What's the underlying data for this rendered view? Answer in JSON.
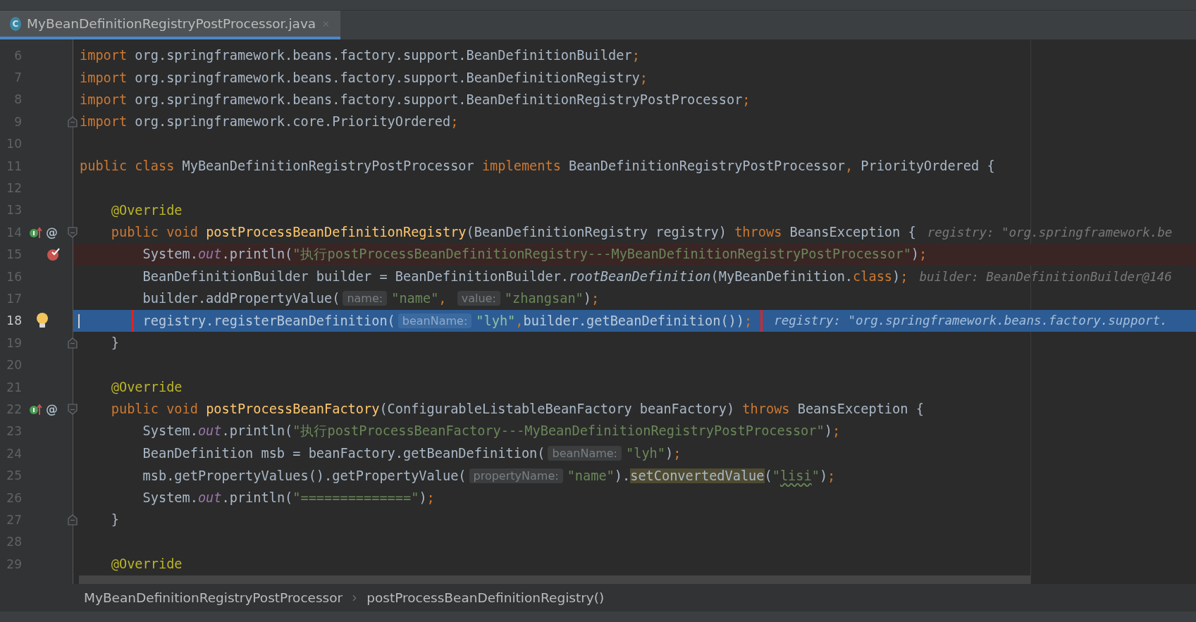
{
  "tab": {
    "icon_letter": "C",
    "title": "MyBeanDefinitionRegistryPostProcessor.java",
    "selected": true
  },
  "lines": [
    {
      "number": "6",
      "current": false,
      "breakpoint": false,
      "boxed": false,
      "parts": [
        {
          "kind": "code",
          "tokens": [
            {
              "kind": "kw",
              "text": "import"
            },
            {
              "kind": "plain",
              "text": " org.springframework.beans.factory.support.BeanDefinitionBuilder"
            },
            {
              "kind": "kw",
              "text": ";"
            }
          ]
        }
      ]
    },
    {
      "number": "7",
      "current": false,
      "breakpoint": false,
      "boxed": false,
      "parts": [
        {
          "kind": "code",
          "tokens": [
            {
              "kind": "kw",
              "text": "import"
            },
            {
              "kind": "plain",
              "text": " org.springframework.beans.factory.support.BeanDefinitionRegistry"
            },
            {
              "kind": "kw",
              "text": ";"
            }
          ]
        }
      ]
    },
    {
      "number": "8",
      "current": false,
      "breakpoint": false,
      "boxed": false,
      "parts": [
        {
          "kind": "code",
          "tokens": [
            {
              "kind": "kw",
              "text": "import"
            },
            {
              "kind": "plain",
              "text": " org.springframework.beans.factory.support.BeanDefinitionRegistryPostProcessor"
            },
            {
              "kind": "kw",
              "text": ";"
            }
          ]
        }
      ]
    },
    {
      "number": "9",
      "current": false,
      "breakpoint": false,
      "boxed": false,
      "gutter": [
        {
          "kind": "fold_end"
        }
      ],
      "parts": [
        {
          "kind": "code",
          "tokens": [
            {
              "kind": "kw",
              "text": "import"
            },
            {
              "kind": "plain",
              "text": " org.springframework.core.PriorityOrdered"
            },
            {
              "kind": "kw",
              "text": ";"
            }
          ]
        }
      ]
    },
    {
      "number": "10",
      "current": false,
      "breakpoint": false,
      "boxed": false
    },
    {
      "number": "11",
      "current": false,
      "breakpoint": false,
      "boxed": false,
      "parts": [
        {
          "kind": "code",
          "tokens": [
            {
              "kind": "kw",
              "text": "public class "
            },
            {
              "kind": "plain",
              "text": "MyBeanDefinitionRegistryPostProcessor "
            },
            {
              "kind": "kw",
              "text": "implements "
            },
            {
              "kind": "plain",
              "text": "BeanDefinitionRegistryPostProcessor"
            },
            {
              "kind": "kw",
              "text": ","
            },
            {
              "kind": "plain",
              "text": " PriorityOrdered {"
            }
          ]
        }
      ]
    },
    {
      "number": "12",
      "current": false,
      "breakpoint": false,
      "boxed": false
    },
    {
      "number": "13",
      "current": false,
      "breakpoint": false,
      "boxed": false,
      "parts": [
        {
          "kind": "code",
          "tokens": [
            {
              "kind": "ann",
              "text": "    @Override"
            }
          ]
        }
      ]
    },
    {
      "number": "14",
      "current": false,
      "breakpoint": false,
      "boxed": false,
      "gutter": [
        {
          "kind": "implements"
        },
        {
          "kind": "override",
          "text": "@"
        },
        {
          "kind": "fold_start"
        }
      ],
      "parts": [
        {
          "kind": "code",
          "tokens": [
            {
              "kind": "kw",
              "text": "    public void "
            },
            {
              "kind": "method",
              "text": "postProcessBeanDefinitionRegistry"
            },
            {
              "kind": "plain",
              "text": "(BeanDefinitionRegistry registry) "
            },
            {
              "kind": "kw",
              "text": "throws "
            },
            {
              "kind": "plain",
              "text": "BeansException {"
            }
          ]
        },
        {
          "kind": "debug",
          "text": "registry: \"org.springframework.be"
        }
      ]
    },
    {
      "number": "15",
      "current": false,
      "breakpoint": true,
      "boxed": false,
      "gutter": [
        {
          "kind": "breakpoint"
        }
      ],
      "parts": [
        {
          "kind": "code",
          "tokens": [
            {
              "kind": "plain",
              "text": "        System."
            },
            {
              "kind": "field",
              "text": "out"
            },
            {
              "kind": "plain",
              "text": ".println("
            },
            {
              "kind": "str",
              "text": "\"执行postProcessBeanDefinitionRegistry---MyBeanDefinitionRegistryPostProcessor\""
            },
            {
              "kind": "plain",
              "text": ")"
            },
            {
              "kind": "kw",
              "text": ";"
            }
          ]
        }
      ]
    },
    {
      "number": "16",
      "current": false,
      "breakpoint": false,
      "boxed": false,
      "parts": [
        {
          "kind": "code",
          "tokens": [
            {
              "kind": "plain",
              "text": "        BeanDefinitionBuilder builder = BeanDefinitionBuilder."
            },
            {
              "kind": "italic",
              "text": "rootBeanDefinition"
            },
            {
              "kind": "plain",
              "text": "(MyBeanDefinition."
            },
            {
              "kind": "kw",
              "text": "class"
            },
            {
              "kind": "plain",
              "text": ")"
            },
            {
              "kind": "kw",
              "text": ";"
            }
          ]
        },
        {
          "kind": "debug",
          "text": "builder: BeanDefinitionBuilder@146"
        }
      ]
    },
    {
      "number": "17",
      "current": false,
      "breakpoint": false,
      "boxed": false,
      "parts": [
        {
          "kind": "code",
          "tokens": [
            {
              "kind": "plain",
              "text": "        builder.addPropertyValue("
            }
          ]
        },
        {
          "kind": "hint",
          "text": "name:"
        },
        {
          "kind": "code",
          "tokens": [
            {
              "kind": "str",
              "text": "\"name\""
            },
            {
              "kind": "kw",
              "text": ", "
            }
          ]
        },
        {
          "kind": "hint",
          "text": "value:"
        },
        {
          "kind": "code",
          "tokens": [
            {
              "kind": "str",
              "text": "\"zhangsan\""
            },
            {
              "kind": "plain",
              "text": ")"
            },
            {
              "kind": "kw",
              "text": ";"
            }
          ]
        }
      ]
    },
    {
      "number": "18",
      "current": true,
      "breakpoint": false,
      "boxed": true,
      "gutter": [
        {
          "kind": "bulb"
        }
      ],
      "parts": [
        {
          "kind": "code",
          "tokens": [
            {
              "kind": "plain",
              "text": "        registry.registerBeanDefinition("
            }
          ]
        },
        {
          "kind": "hint",
          "text": "beanName:"
        },
        {
          "kind": "code",
          "tokens": [
            {
              "kind": "str",
              "text": "\"lyh\""
            },
            {
              "kind": "kw",
              "text": ","
            },
            {
              "kind": "plain",
              "text": "builder.getBeanDefinition())"
            },
            {
              "kind": "kw",
              "text": ";"
            }
          ]
        },
        {
          "kind": "debug",
          "text": "registry: \"org.springframework.beans.factory.support."
        }
      ]
    },
    {
      "number": "19",
      "current": false,
      "breakpoint": false,
      "boxed": false,
      "gutter": [
        {
          "kind": "fold_end"
        }
      ],
      "parts": [
        {
          "kind": "code",
          "tokens": [
            {
              "kind": "plain",
              "text": "    }"
            }
          ]
        }
      ]
    },
    {
      "number": "20",
      "current": false,
      "breakpoint": false,
      "boxed": false
    },
    {
      "number": "21",
      "current": false,
      "breakpoint": false,
      "boxed": false,
      "parts": [
        {
          "kind": "code",
          "tokens": [
            {
              "kind": "ann",
              "text": "    @Override"
            }
          ]
        }
      ]
    },
    {
      "number": "22",
      "current": false,
      "breakpoint": false,
      "boxed": false,
      "gutter": [
        {
          "kind": "implements"
        },
        {
          "kind": "override",
          "text": "@"
        },
        {
          "kind": "fold_start"
        }
      ],
      "parts": [
        {
          "kind": "code",
          "tokens": [
            {
              "kind": "kw",
              "text": "    public void "
            },
            {
              "kind": "method",
              "text": "postProcessBeanFactory"
            },
            {
              "kind": "plain",
              "text": "(ConfigurableListableBeanFactory beanFactory) "
            },
            {
              "kind": "kw",
              "text": "throws "
            },
            {
              "kind": "plain",
              "text": "BeansException {"
            }
          ]
        }
      ]
    },
    {
      "number": "23",
      "current": false,
      "breakpoint": false,
      "boxed": false,
      "parts": [
        {
          "kind": "code",
          "tokens": [
            {
              "kind": "plain",
              "text": "        System."
            },
            {
              "kind": "field",
              "text": "out"
            },
            {
              "kind": "plain",
              "text": ".println("
            },
            {
              "kind": "str",
              "text": "\"执行postProcessBeanFactory---MyBeanDefinitionRegistryPostProcessor\""
            },
            {
              "kind": "plain",
              "text": ")"
            },
            {
              "kind": "kw",
              "text": ";"
            }
          ]
        }
      ]
    },
    {
      "number": "24",
      "current": false,
      "breakpoint": false,
      "boxed": false,
      "parts": [
        {
          "kind": "code",
          "tokens": [
            {
              "kind": "plain",
              "text": "        BeanDefinition msb = beanFactory.getBeanDefinition("
            }
          ]
        },
        {
          "kind": "hint",
          "text": "beanName:"
        },
        {
          "kind": "code",
          "tokens": [
            {
              "kind": "str",
              "text": "\"lyh\""
            },
            {
              "kind": "plain",
              "text": ")"
            },
            {
              "kind": "kw",
              "text": ";"
            }
          ]
        }
      ]
    },
    {
      "number": "25",
      "current": false,
      "breakpoint": false,
      "boxed": false,
      "parts": [
        {
          "kind": "code",
          "tokens": [
            {
              "kind": "plain",
              "text": "        msb.getPropertyValues().getPropertyValue("
            }
          ]
        },
        {
          "kind": "hint",
          "text": "propertyName:"
        },
        {
          "kind": "code",
          "tokens": [
            {
              "kind": "str",
              "text": "\"name\""
            },
            {
              "kind": "plain",
              "text": ")."
            },
            {
              "kind": "usage",
              "text": "setConvertedValue"
            },
            {
              "kind": "plain",
              "text": "("
            },
            {
              "kind": "str",
              "text": "\""
            },
            {
              "kind": "typo",
              "text": "lisi"
            },
            {
              "kind": "str",
              "text": "\""
            },
            {
              "kind": "plain",
              "text": ")"
            },
            {
              "kind": "kw",
              "text": ";"
            }
          ]
        }
      ]
    },
    {
      "number": "26",
      "current": false,
      "breakpoint": false,
      "boxed": false,
      "parts": [
        {
          "kind": "code",
          "tokens": [
            {
              "kind": "plain",
              "text": "        System."
            },
            {
              "kind": "field",
              "text": "out"
            },
            {
              "kind": "plain",
              "text": ".println("
            },
            {
              "kind": "str",
              "text": "\"==============\""
            },
            {
              "kind": "plain",
              "text": ")"
            },
            {
              "kind": "kw",
              "text": ";"
            }
          ]
        }
      ]
    },
    {
      "number": "27",
      "current": false,
      "breakpoint": false,
      "boxed": false,
      "gutter": [
        {
          "kind": "fold_end"
        }
      ],
      "parts": [
        {
          "kind": "code",
          "tokens": [
            {
              "kind": "plain",
              "text": "    }"
            }
          ]
        }
      ]
    },
    {
      "number": "28",
      "current": false,
      "breakpoint": false,
      "boxed": false
    },
    {
      "number": "29",
      "current": false,
      "breakpoint": false,
      "boxed": false,
      "parts": [
        {
          "kind": "code",
          "tokens": [
            {
              "kind": "ann",
              "text": "    @Override"
            }
          ]
        }
      ]
    }
  ],
  "breadcrumbs": [
    "MyBeanDefinitionRegistryPostProcessor",
    "postProcessBeanDefinitionRegistry()"
  ]
}
